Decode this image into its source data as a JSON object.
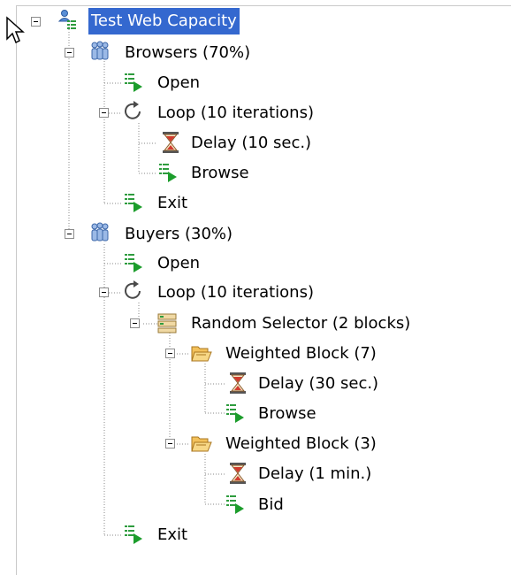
{
  "tree": {
    "root": {
      "label": "Test Web Capacity"
    },
    "browsers": {
      "label": "Browsers (70%)"
    },
    "browsers_open": {
      "label": "Open"
    },
    "browsers_loop": {
      "label": "Loop (10 iterations)"
    },
    "browsers_delay": {
      "label": "Delay (10 sec.)"
    },
    "browsers_browse": {
      "label": "Browse"
    },
    "browsers_exit": {
      "label": "Exit"
    },
    "buyers": {
      "label": "Buyers (30%)"
    },
    "buyers_open": {
      "label": "Open"
    },
    "buyers_loop": {
      "label": "Loop (10 iterations)"
    },
    "random_selector": {
      "label": "Random Selector (2 blocks)"
    },
    "weighted_block_7": {
      "label": "Weighted Block (7)"
    },
    "wb7_delay": {
      "label": "Delay (30 sec.)"
    },
    "wb7_browse": {
      "label": "Browse"
    },
    "weighted_block_3": {
      "label": "Weighted Block (3)"
    },
    "wb3_delay": {
      "label": "Delay (1 min.)"
    },
    "wb3_bid": {
      "label": "Bid"
    },
    "buyers_exit": {
      "label": "Exit"
    }
  },
  "colors": {
    "selection": "#3468cf",
    "page_icon": "#2e9c3e",
    "play_arrow": "#1c9d2c",
    "folder": "#e8a53a",
    "hourglass": "#c0392b"
  }
}
